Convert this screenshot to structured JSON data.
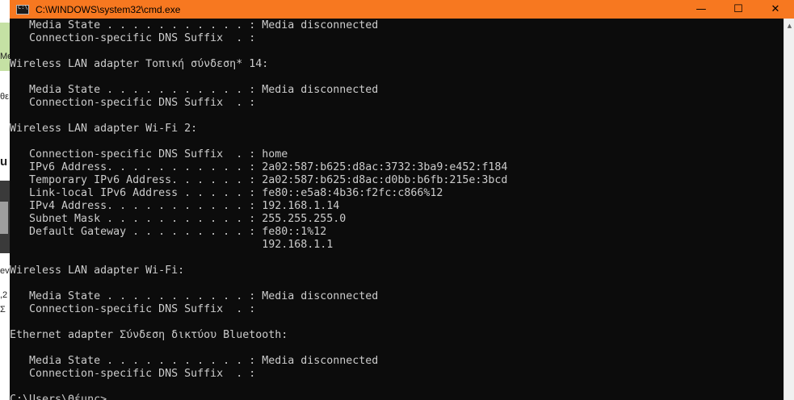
{
  "window": {
    "title": "C:\\WINDOWS\\system32\\cmd.exe",
    "controls": {
      "minimize": "—",
      "maximize": "☐",
      "close": "✕"
    }
  },
  "desktop_fragments": [
    "Me",
    "θε",
    "u",
    "ev",
    ",2",
    "Σ"
  ],
  "console": {
    "lines": [
      "   Media State . . . . . . . . . . . : Media disconnected",
      "   Connection-specific DNS Suffix  . :",
      "",
      "Wireless LAN adapter Τοπική σύνδεση* 14:",
      "",
      "   Media State . . . . . . . . . . . : Media disconnected",
      "   Connection-specific DNS Suffix  . :",
      "",
      "Wireless LAN adapter Wi-Fi 2:",
      "",
      "   Connection-specific DNS Suffix  . : home",
      "   IPv6 Address. . . . . . . . . . . : 2a02:587:b625:d8ac:3732:3ba9:e452:f184",
      "   Temporary IPv6 Address. . . . . . : 2a02:587:b625:d8ac:d0bb:b6fb:215e:3bcd",
      "   Link-local IPv6 Address . . . . . : fe80::e5a8:4b36:f2fc:c866%12",
      "   IPv4 Address. . . . . . . . . . . : 192.168.1.14",
      "   Subnet Mask . . . . . . . . . . . : 255.255.255.0",
      "   Default Gateway . . . . . . . . . : fe80::1%12",
      "                                       192.168.1.1",
      "",
      "Wireless LAN adapter Wi-Fi:",
      "",
      "   Media State . . . . . . . . . . . : Media disconnected",
      "   Connection-specific DNS Suffix  . :",
      "",
      "Ethernet adapter Σύνδεση δικτύου Bluetooth:",
      "",
      "   Media State . . . . . . . . . . . : Media disconnected",
      "   Connection-specific DNS Suffix  . :",
      "",
      "C:\\Users\\Θέμης>"
    ]
  },
  "scrollbar": {
    "up_arrow": "▲"
  },
  "colors": {
    "titlebar": "#f77820",
    "console_bg": "#0c0c0c",
    "console_text": "#cccccc"
  }
}
